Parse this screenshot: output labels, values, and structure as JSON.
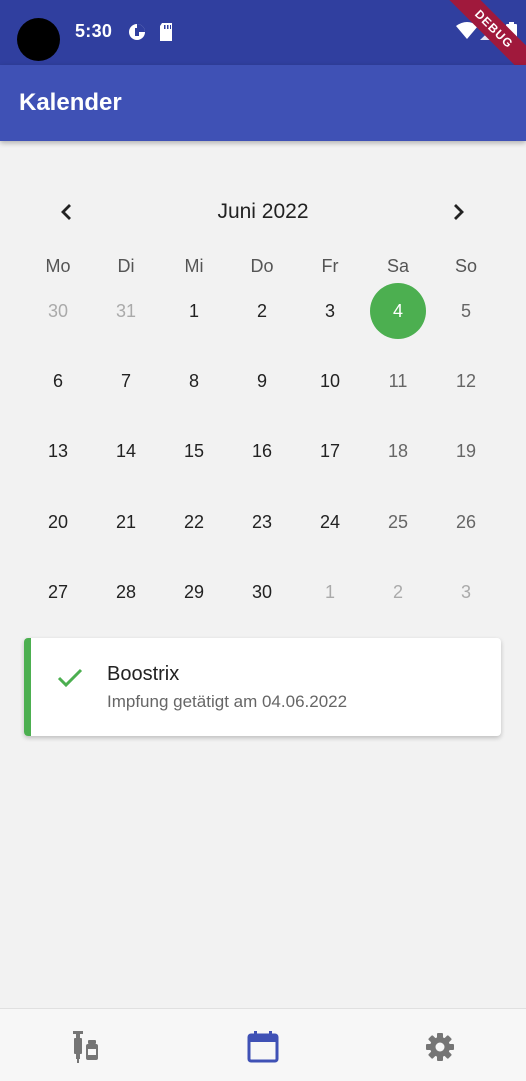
{
  "status_bar": {
    "time": "5:30",
    "debug_label": "DEBUG"
  },
  "app_bar": {
    "title": "Kalender"
  },
  "calendar": {
    "month_label": "Juni 2022",
    "weekdays": [
      "Mo",
      "Di",
      "Mi",
      "Do",
      "Fr",
      "Sa",
      "So"
    ],
    "weeks": [
      [
        "30",
        "31",
        "1",
        "2",
        "3",
        "4",
        "5"
      ],
      [
        "6",
        "7",
        "8",
        "9",
        "10",
        "11",
        "12"
      ],
      [
        "13",
        "14",
        "15",
        "16",
        "17",
        "18",
        "19"
      ],
      [
        "20",
        "21",
        "22",
        "23",
        "24",
        "25",
        "26"
      ],
      [
        "27",
        "28",
        "29",
        "30",
        "1",
        "2",
        "3"
      ]
    ],
    "selected_day": "4"
  },
  "event": {
    "title": "Boostrix",
    "subtitle": "Impfung getätigt am 04.06.2022",
    "icon": "check-icon"
  },
  "bottom_nav": {
    "items": [
      {
        "icon": "vaccine-icon",
        "active": false
      },
      {
        "icon": "calendar-icon",
        "active": true
      },
      {
        "icon": "settings-gear-icon",
        "active": false
      }
    ]
  },
  "colors": {
    "primary": "#3f51b5",
    "primary_dark": "#303f9f",
    "accent_green": "#4caf50",
    "debug_ribbon": "#a0193c"
  }
}
